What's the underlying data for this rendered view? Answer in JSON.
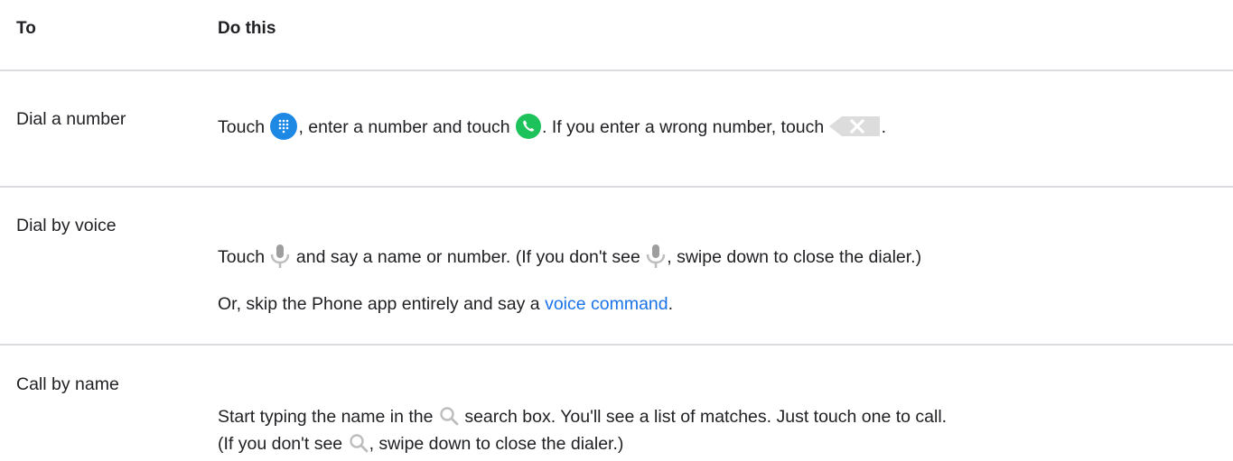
{
  "header": {
    "col_to": "To",
    "col_do": "Do this"
  },
  "rows": [
    {
      "label": "Dial a number",
      "p1": "Touch",
      "p2": ", enter a number and touch",
      "p3": ". If you enter a wrong number, touch",
      "p4": "."
    },
    {
      "label": "Dial by voice",
      "l1a": "Touch",
      "l1b": "and say a name or number. (If you don't see",
      "l1c": ", swipe down to close the dialer.)",
      "l2a": "Or, skip the Phone app entirely and say a",
      "link": "voice command",
      "l2b": "."
    },
    {
      "label": "Call by name",
      "l1a": "Start typing the name in the",
      "l1b": "search box. You'll see a list of matches. Just touch one to call.",
      "l2a": "(If you don't see",
      "l2b": ", swipe down to close the dialer.)"
    }
  ],
  "icons": {
    "dialpad": "dialpad-icon",
    "call": "call-icon",
    "backspace": "backspace-icon",
    "mic": "mic-icon",
    "search": "search-icon"
  },
  "colors": {
    "dialpad_bg": "#1e88e5",
    "call_bg": "#1ec25a",
    "link": "#1a73e8",
    "rule": "#dadce0",
    "icon_gray": "#bdbdbd"
  }
}
